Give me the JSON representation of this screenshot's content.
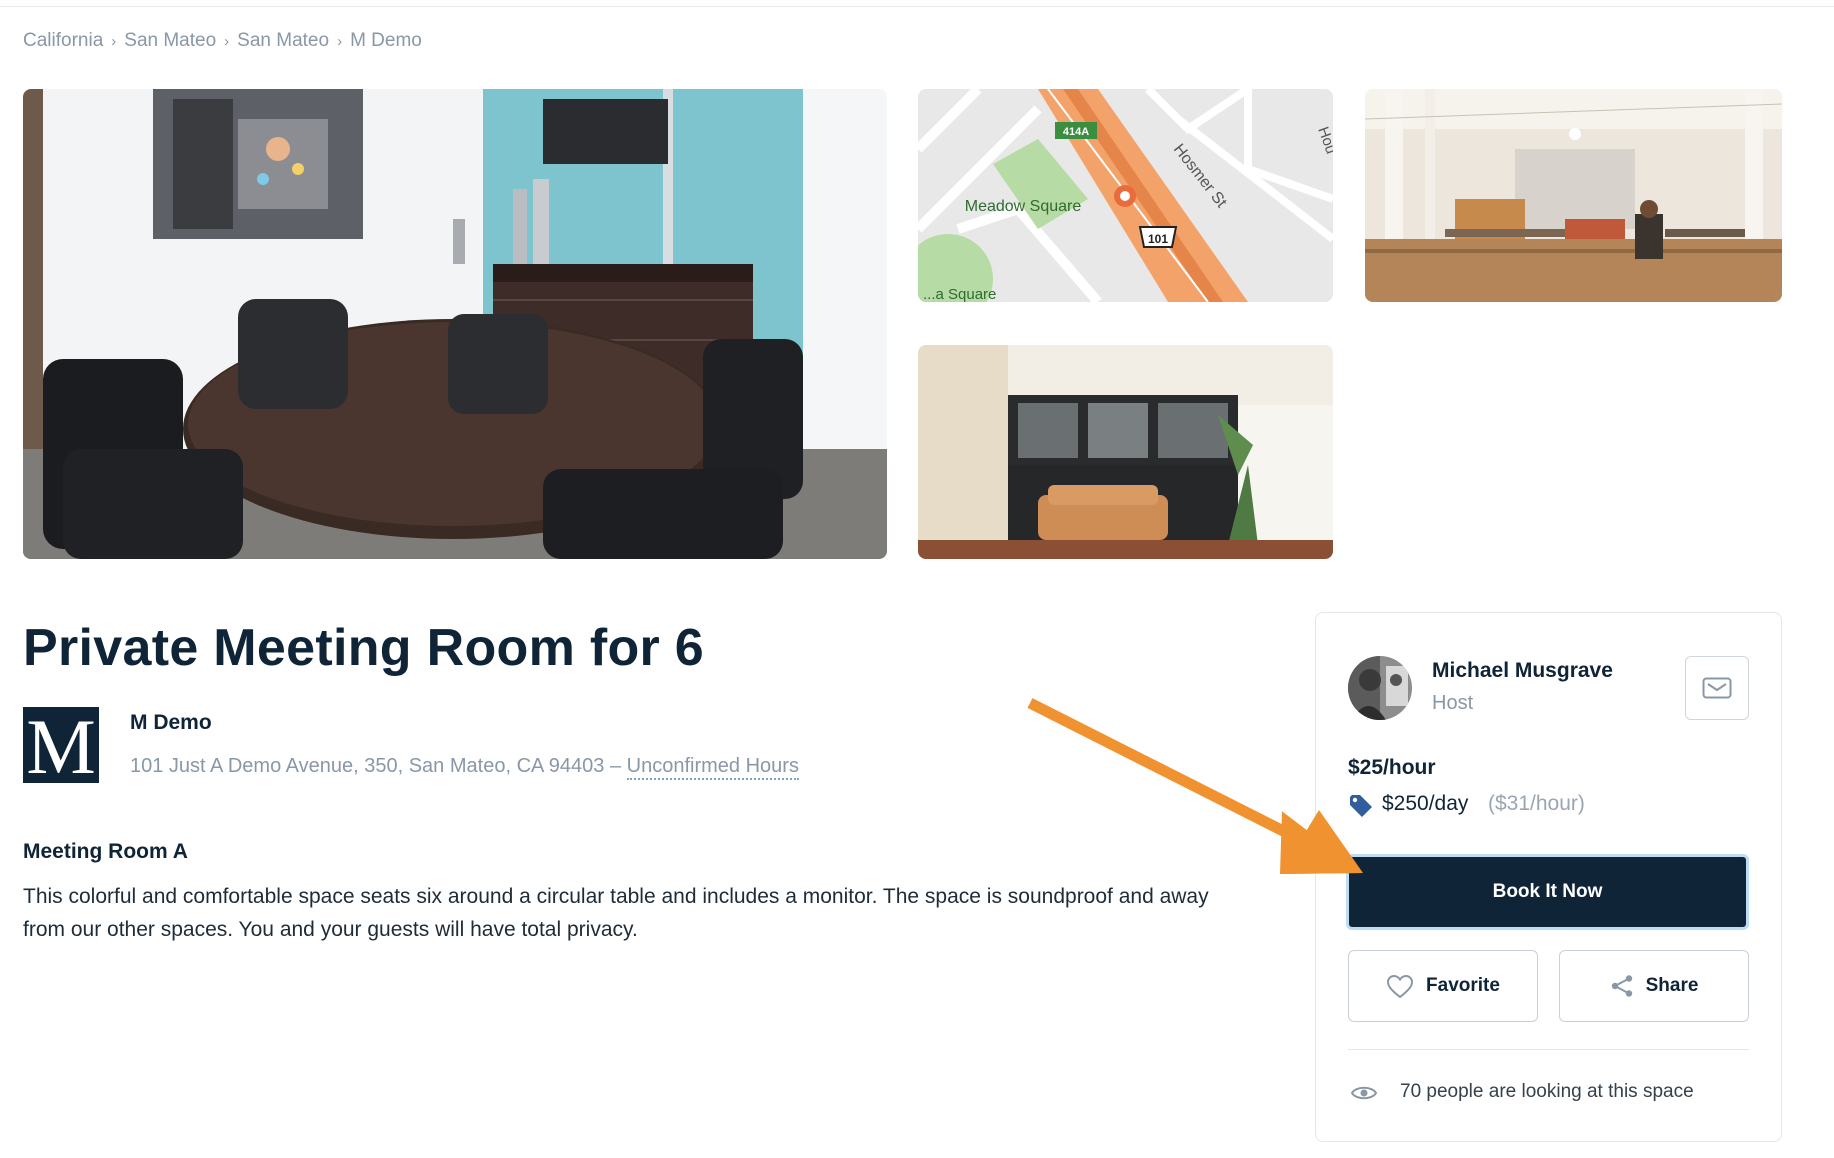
{
  "breadcrumb": [
    {
      "label": "California"
    },
    {
      "label": "San Mateo"
    },
    {
      "label": "San Mateo"
    },
    {
      "label": "M Demo"
    }
  ],
  "breadcrumb_separator": "›",
  "gallery": {
    "map": {
      "street_label": "Hosmer St",
      "park_label": "Meadow Square",
      "park_label_2": "...a Square",
      "exit_label": "414A",
      "highway_label": "101",
      "edge_label": "Hou"
    }
  },
  "listing": {
    "title": "Private Meeting Room for 6",
    "logo_letter": "M",
    "company_name": "M Demo",
    "address": "101 Just A Demo Avenue, 350, San Mateo, CA 94403 –",
    "hours_link": "Unconfirmed Hours",
    "space_name": "Meeting Room A",
    "description": "This colorful and comfortable space seats six around a circular table and includes a monitor. The space is soundproof and away from our other spaces. You and your guests will have total privacy."
  },
  "sidebar": {
    "host_name": "Michael Musgrave",
    "host_role": "Host",
    "price_hourly": "$25/hour",
    "price_daily": "$250/day",
    "price_daily_note": "($31/hour)",
    "book_label": "Book It Now",
    "favorite_label": "Favorite",
    "share_label": "Share",
    "viewers_text": "70 people are looking at this space"
  },
  "icons": {
    "message": "envelope-icon",
    "price_tag": "tag-icon",
    "favorite": "heart-icon",
    "share": "share-icon",
    "viewers": "eye-icon"
  },
  "colors": {
    "brand_navy": "#0f2436",
    "annotation_orange": "#f0922f",
    "muted_text": "#8a97a6",
    "tag_blue": "#2f5d9e"
  }
}
